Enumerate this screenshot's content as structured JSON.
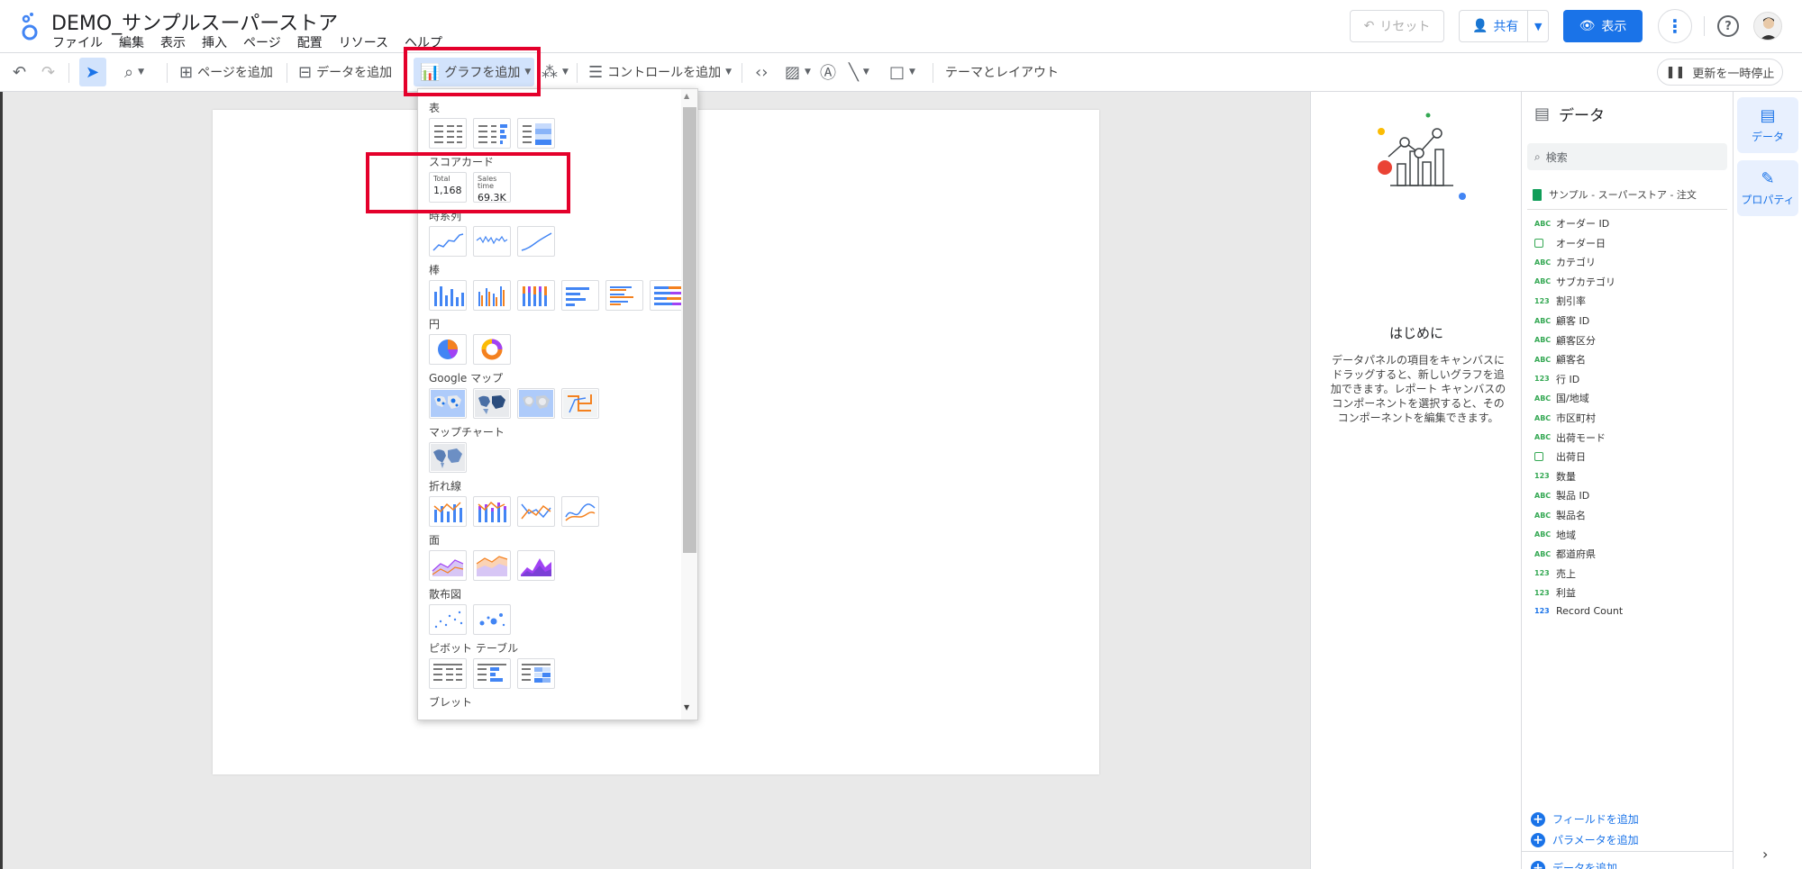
{
  "window": {
    "doc_title": "DEMO_サンプルスーパーストア",
    "menu": [
      "ファイル",
      "編集",
      "表示",
      "挿入",
      "ページ",
      "配置",
      "リソース",
      "ヘルプ"
    ],
    "reset_label": "リセット",
    "share_label": "共有",
    "view_label": "表示"
  },
  "toolbar": {
    "add_page": "ページを追加",
    "add_data": "データを追加",
    "add_chart": "グラフを追加",
    "add_control": "コントロールを追加",
    "theme_layout": "テーマとレイアウト",
    "pause_updates": "更新を一時停止"
  },
  "chart_menu": {
    "sections": {
      "table": "表",
      "scorecard": "スコアカード",
      "timeseries": "時系列",
      "bar": "棒",
      "pie": "円",
      "google_maps": "Google マップ",
      "map_chart": "マップチャート",
      "line": "折れ線",
      "area": "面",
      "scatter": "散布図",
      "pivot": "ピボット テーブル",
      "bullet": "ブレット"
    },
    "scorecards": [
      {
        "label": "Total",
        "value": "1,168"
      },
      {
        "label": "Sales time",
        "value": "69.3K"
      }
    ]
  },
  "intro": {
    "title": "はじめに",
    "text": "データパネルの項目をキャンバスにドラッグすると、新しいグラフを追加できます。レポート キャンバスのコンポーネントを選択すると、そのコンポーネントを編集できます。"
  },
  "data_panel": {
    "title": "データ",
    "search_placeholder": "検索",
    "source": "サンプル - スーパーストア - 注文",
    "fields": [
      {
        "type": "ABC",
        "name": "オーダー ID"
      },
      {
        "type": "date",
        "name": "オーダー日"
      },
      {
        "type": "ABC",
        "name": "カテゴリ"
      },
      {
        "type": "ABC",
        "name": "サブカテゴリ"
      },
      {
        "type": "123",
        "name": "割引率"
      },
      {
        "type": "ABC",
        "name": "顧客 ID"
      },
      {
        "type": "ABC",
        "name": "顧客区分"
      },
      {
        "type": "ABC",
        "name": "顧客名"
      },
      {
        "type": "123",
        "name": "行 ID"
      },
      {
        "type": "ABC",
        "name": "国/地域"
      },
      {
        "type": "ABC",
        "name": "市区町村"
      },
      {
        "type": "ABC",
        "name": "出荷モード"
      },
      {
        "type": "date",
        "name": "出荷日"
      },
      {
        "type": "123",
        "name": "数量"
      },
      {
        "type": "ABC",
        "name": "製品 ID"
      },
      {
        "type": "ABC",
        "name": "製品名"
      },
      {
        "type": "ABC",
        "name": "地域"
      },
      {
        "type": "ABC",
        "name": "都道府県"
      },
      {
        "type": "123",
        "name": "売上"
      },
      {
        "type": "123",
        "name": "利益"
      },
      {
        "type": "123c",
        "name": "Record Count"
      }
    ],
    "add_field": "フィールドを追加",
    "add_parameter": "パラメータを追加",
    "add_data": "データを追加"
  },
  "rail": {
    "data": "データ",
    "properties": "プロパティ"
  },
  "colors": {
    "accent": "#1a73e8",
    "highlight_box": "#e4002b",
    "chart_blue": "#4285f4",
    "chart_orange": "#f4811f",
    "chart_purple": "#a142f4"
  }
}
